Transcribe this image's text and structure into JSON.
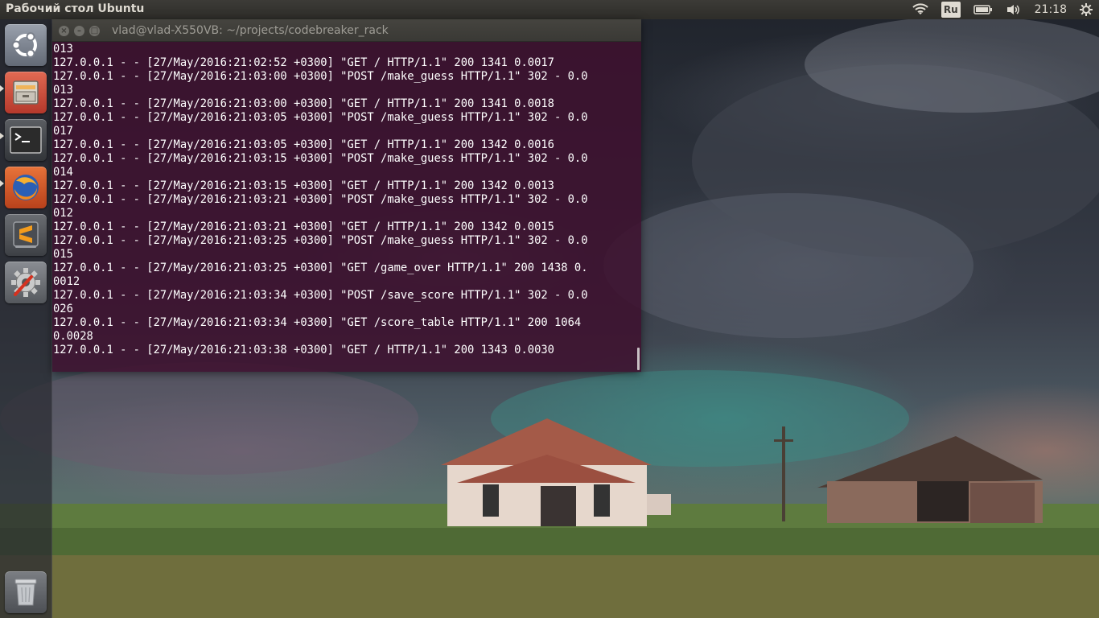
{
  "top_panel": {
    "title": "Рабочий стол Ubuntu",
    "language": "Ru",
    "clock": "21:18"
  },
  "launcher": {
    "items": [
      {
        "name": "ubuntu-dash",
        "icon": "ubuntu-logo-icon"
      },
      {
        "name": "files",
        "icon": "file-cabinet-icon",
        "running": true
      },
      {
        "name": "terminal",
        "icon": "terminal-icon",
        "running": true
      },
      {
        "name": "firefox",
        "icon": "firefox-icon",
        "running": true
      },
      {
        "name": "sublime-text",
        "icon": "sublime-text-icon"
      },
      {
        "name": "system-settings",
        "icon": "settings-gear-icon"
      },
      {
        "name": "trash",
        "icon": "trash-icon"
      }
    ]
  },
  "terminal": {
    "title": "vlad@vlad-X550VB: ~/projects/codebreaker_rack",
    "lines": [
      "013",
      "127.0.0.1 - - [27/May/2016:21:02:52 +0300] \"GET / HTTP/1.1\" 200 1341 0.0017",
      "127.0.0.1 - - [27/May/2016:21:03:00 +0300] \"POST /make_guess HTTP/1.1\" 302 - 0.0",
      "013",
      "127.0.0.1 - - [27/May/2016:21:03:00 +0300] \"GET / HTTP/1.1\" 200 1341 0.0018",
      "127.0.0.1 - - [27/May/2016:21:03:05 +0300] \"POST /make_guess HTTP/1.1\" 302 - 0.0",
      "017",
      "127.0.0.1 - - [27/May/2016:21:03:05 +0300] \"GET / HTTP/1.1\" 200 1342 0.0016",
      "127.0.0.1 - - [27/May/2016:21:03:15 +0300] \"POST /make_guess HTTP/1.1\" 302 - 0.0",
      "014",
      "127.0.0.1 - - [27/May/2016:21:03:15 +0300] \"GET / HTTP/1.1\" 200 1342 0.0013",
      "127.0.0.1 - - [27/May/2016:21:03:21 +0300] \"POST /make_guess HTTP/1.1\" 302 - 0.0",
      "012",
      "127.0.0.1 - - [27/May/2016:21:03:21 +0300] \"GET / HTTP/1.1\" 200 1342 0.0015",
      "127.0.0.1 - - [27/May/2016:21:03:25 +0300] \"POST /make_guess HTTP/1.1\" 302 - 0.0",
      "015",
      "127.0.0.1 - - [27/May/2016:21:03:25 +0300] \"GET /game_over HTTP/1.1\" 200 1438 0.",
      "0012",
      "127.0.0.1 - - [27/May/2016:21:03:34 +0300] \"POST /save_score HTTP/1.1\" 302 - 0.0",
      "026",
      "127.0.0.1 - - [27/May/2016:21:03:34 +0300] \"GET /score_table HTTP/1.1\" 200 1064",
      "0.0028",
      "127.0.0.1 - - [27/May/2016:21:03:38 +0300] \"GET / HTTP/1.1\" 200 1343 0.0030"
    ]
  }
}
